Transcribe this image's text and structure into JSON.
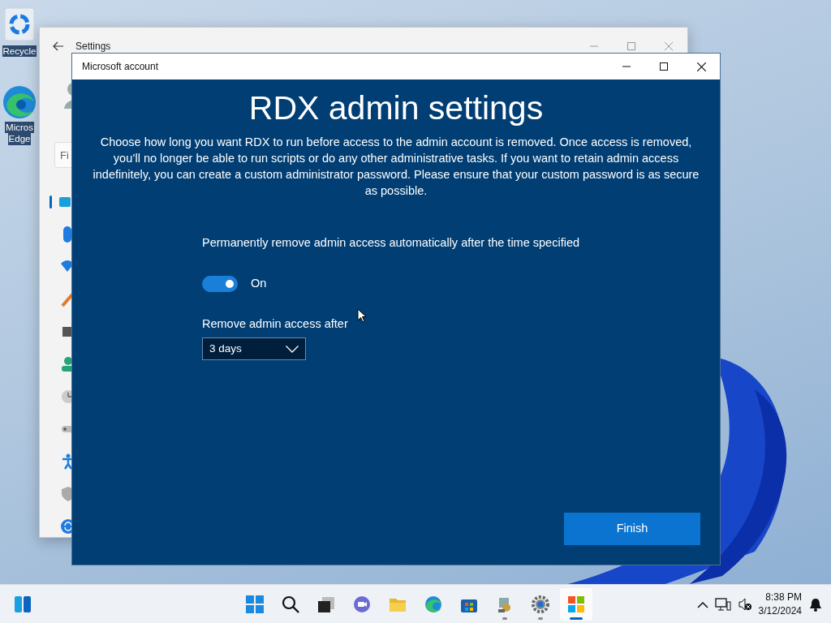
{
  "desktop_icons": [
    {
      "kind": "recycle",
      "lines": [
        "Recycle"
      ]
    },
    {
      "kind": "edge",
      "lines": [
        "Micros",
        "Edge"
      ]
    }
  ],
  "settings_window": {
    "title": "Settings",
    "search": {
      "placeholder": "Fi"
    }
  },
  "dialog": {
    "title": "Microsoft account",
    "heading": "RDX admin settings",
    "description": "Choose how long you want RDX to run before access to the admin account is removed. Once access is removed, you’ll no longer be able to run scripts or do any other administrative tasks. If you want to retain admin access indefinitely, you can create a custom administrator password. Please ensure that your custom password is as secure as possible.",
    "toggle": {
      "label": "Permanently remove admin access automatically after the time specified",
      "on": true,
      "state_text": "On"
    },
    "dropdown": {
      "label": "Remove admin access after",
      "value": "3 days"
    },
    "finish_button": "Finish"
  },
  "taskbar": {
    "apps": [
      {
        "kind": "widgets",
        "running": false,
        "active": false
      },
      {
        "kind": "start",
        "running": false,
        "active": false
      },
      {
        "kind": "search",
        "running": false,
        "active": false
      },
      {
        "kind": "taskview",
        "running": false,
        "active": false
      },
      {
        "kind": "chat",
        "running": false,
        "active": false
      },
      {
        "kind": "folder",
        "running": false,
        "active": false
      },
      {
        "kind": "edge",
        "running": false,
        "active": false
      },
      {
        "kind": "store",
        "running": false,
        "active": false
      },
      {
        "kind": "setup",
        "running": true,
        "active": false
      },
      {
        "kind": "gear",
        "running": true,
        "active": false
      },
      {
        "kind": "squares",
        "running": true,
        "active": true
      }
    ],
    "time": "8:38 PM",
    "date": "3/12/2024"
  }
}
